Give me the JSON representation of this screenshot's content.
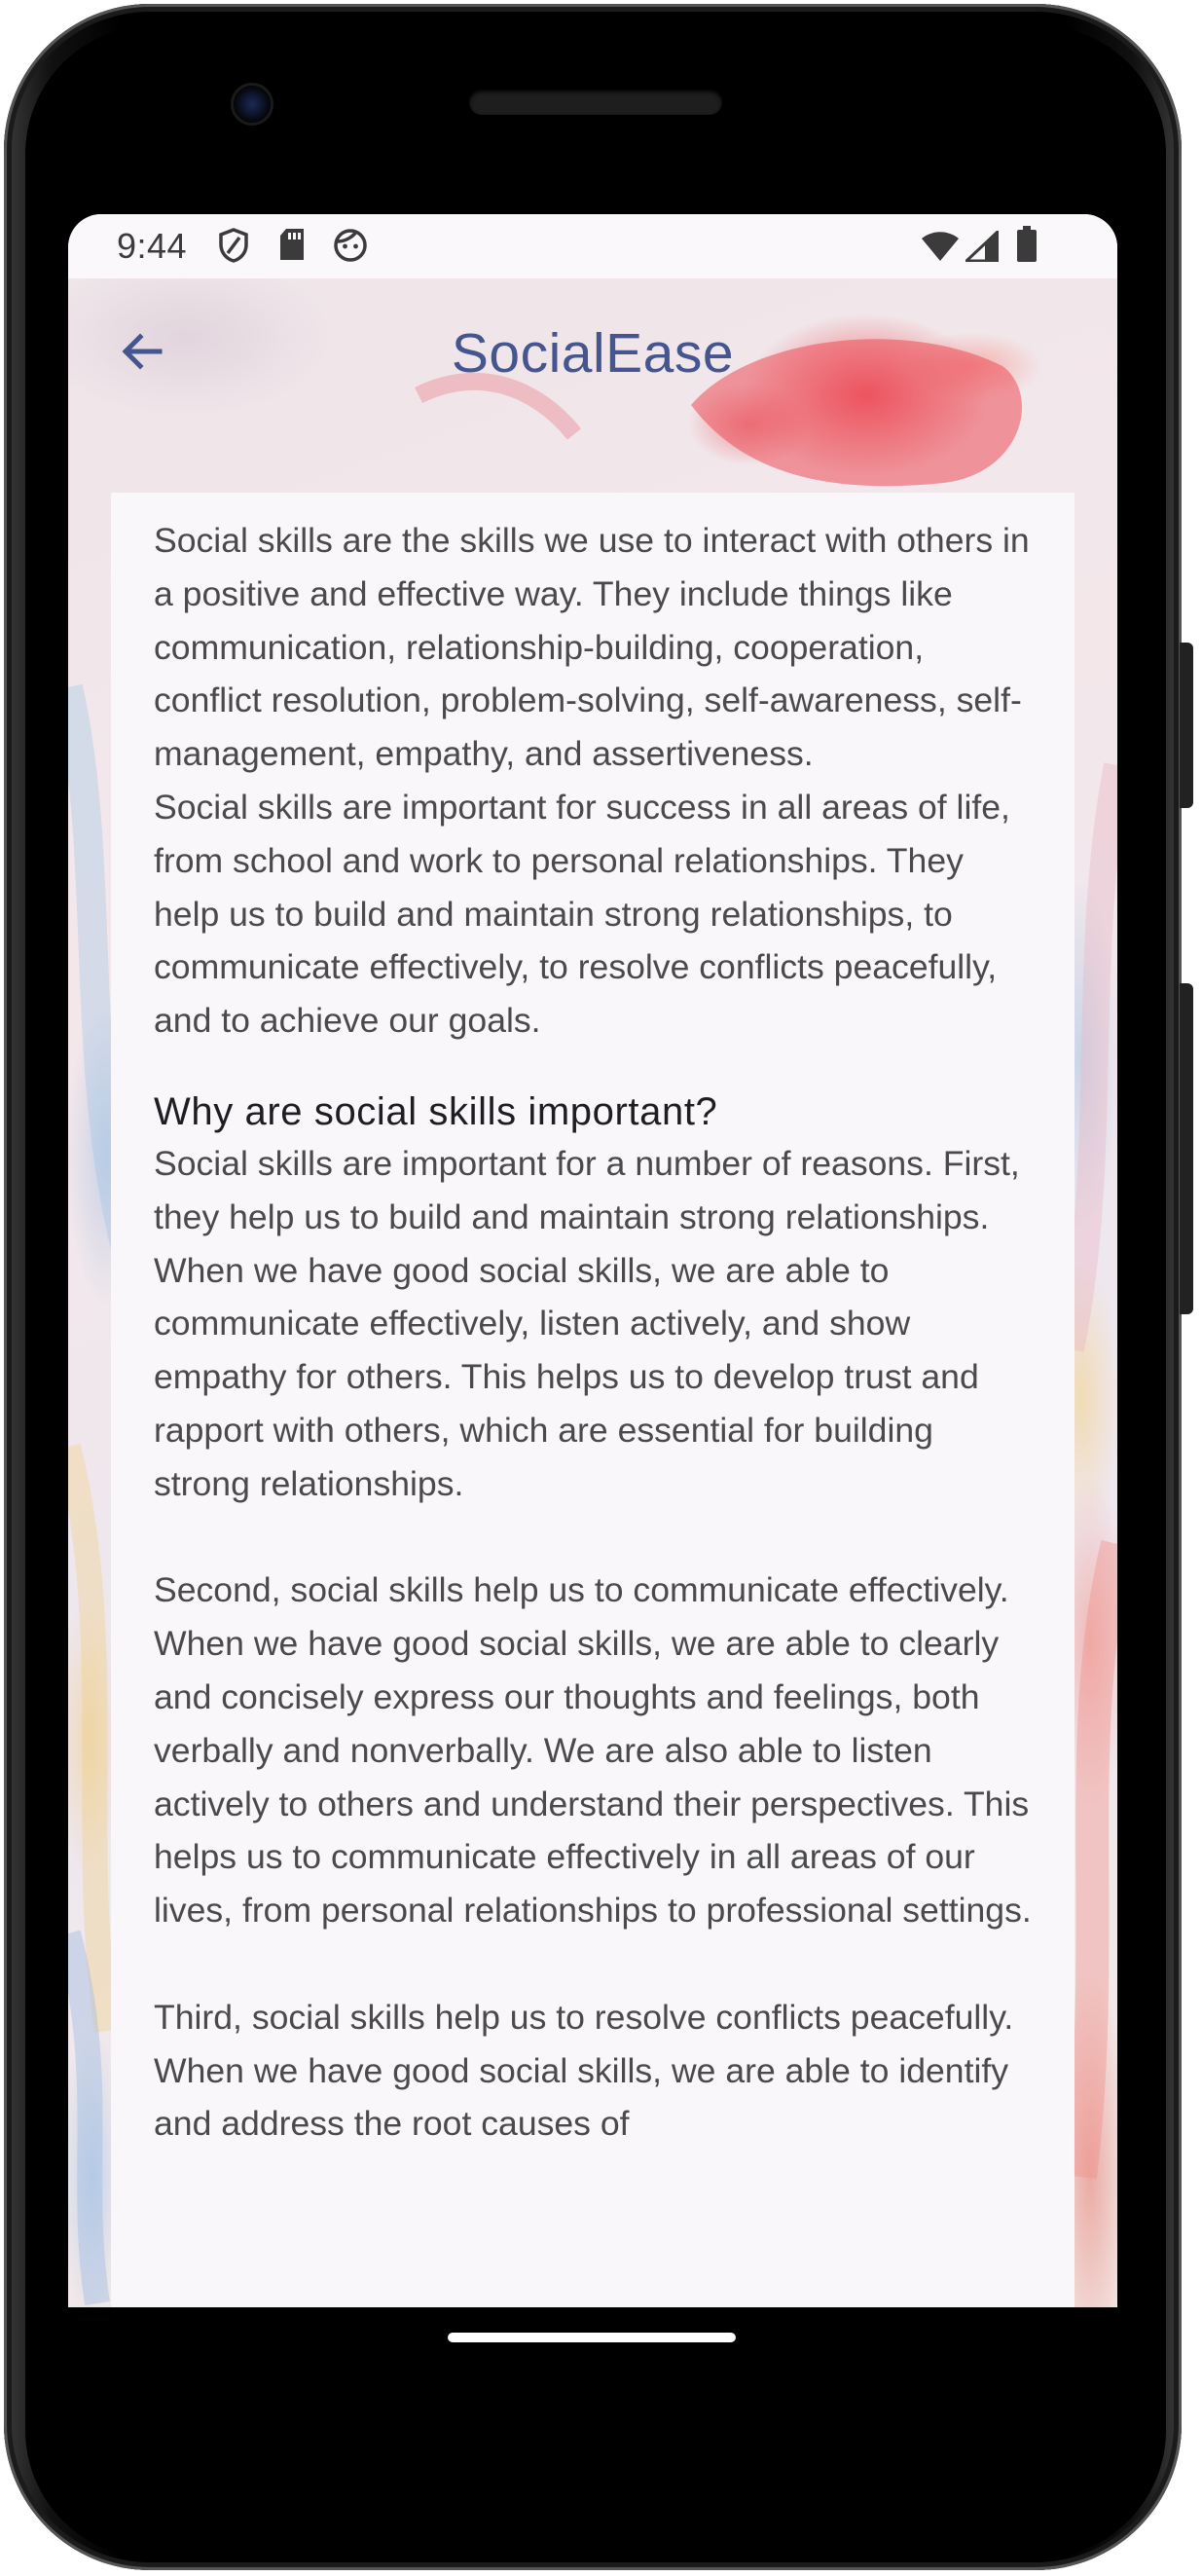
{
  "status_bar": {
    "time": "9:44",
    "icons": [
      "shield-icon",
      "sd-card-icon",
      "face-icon",
      "wifi-icon",
      "signal-icon",
      "battery-icon"
    ]
  },
  "app_bar": {
    "back_icon": "arrow-back-icon",
    "title": "SocialEase",
    "title_color": "#44558f"
  },
  "content": {
    "intro_1": "Social skills are the skills we use to interact with others in a positive and effective way. They include things like communication, relationship-building, cooperation, conflict resolution, problem-solving, self-awareness, self-management, empathy, and assertiveness.",
    "intro_2": "Social skills are important for success in all areas of life, from school and work to personal relationships. They help us to build and maintain strong relationships, to communicate effectively, to resolve conflicts peacefully, and to achieve our goals.",
    "heading": "Why are social skills important?",
    "reason_1": "Social skills are important for a number of reasons. First, they help us to build and maintain strong relationships. When we have good social skills, we are able to communicate effectively, listen actively, and show empathy for others. This helps us to develop trust and rapport with others, which are essential for building strong relationships.",
    "reason_2": "Second, social skills help us to communicate effectively. When we have good social skills, we are able to clearly and concisely express our thoughts and feelings, both verbally and nonverbally. We are also able to listen actively to others and understand their perspectives. This helps us to communicate effectively in all areas of our lives, from personal relationships to professional settings.",
    "reason_3": "Third, social skills help us to resolve conflicts peacefully. When we have good social skills, we are able to identify and address the root causes of"
  }
}
